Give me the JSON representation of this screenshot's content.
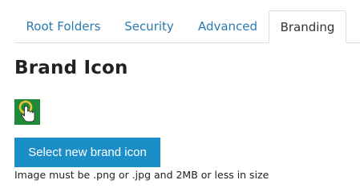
{
  "tabs": {
    "items": [
      {
        "label": "Root Folders",
        "active": false
      },
      {
        "label": "Security",
        "active": false
      },
      {
        "label": "Advanced",
        "active": false
      },
      {
        "label": "Branding",
        "active": true
      }
    ]
  },
  "branding": {
    "heading": "Brand Icon",
    "icon_name": "hand-pointer-icon",
    "select_button_label": "Select new brand icon",
    "hint": "Image must be .png or .jpg and 2MB or less in size"
  },
  "colors": {
    "tab_link": "#2a7ab0",
    "button_bg": "#1b8ec8",
    "icon_bg": "#1f8b3a"
  }
}
